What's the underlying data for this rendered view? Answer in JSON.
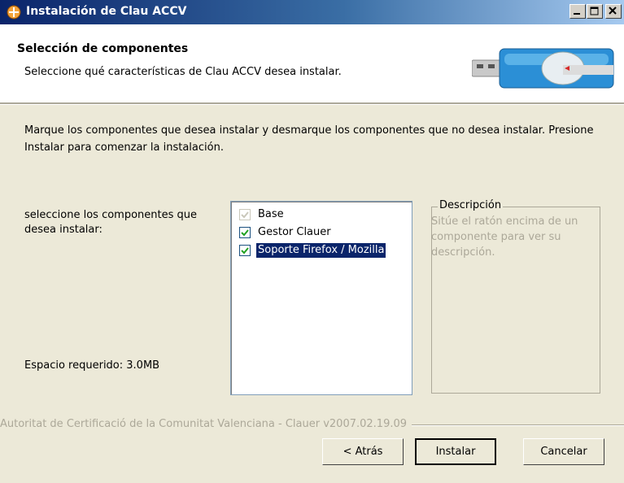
{
  "window": {
    "title": "Instalación de Clau ACCV"
  },
  "header": {
    "title": "Selección de componentes",
    "subtitle": "Seleccione qué características de Clau ACCV desea instalar."
  },
  "intro": "Marque los componentes que desea instalar y desmarque los componentes que no desea instalar. Presione Instalar para comenzar la instalación.",
  "select_label": "seleccione los componentes que desea instalar:",
  "space_required": "Espacio requerido: 3.0MB",
  "components": [
    {
      "label": "Base",
      "checked": true,
      "disabled": true
    },
    {
      "label": "Gestor Clauer",
      "checked": true,
      "disabled": false
    },
    {
      "label": "Soporte Firefox / Mozilla",
      "checked": true,
      "disabled": false,
      "selected": true
    }
  ],
  "description": {
    "legend": "Descripción",
    "text": "Sitúe el ratón encima de un componente para ver su descripción."
  },
  "footer_text": "Autoritat de Certificació de la Comunitat Valenciana - Clauer v2007.02.19.09",
  "buttons": {
    "back": "< Atrás",
    "install": "Instalar",
    "cancel": "Cancelar"
  },
  "colors": {
    "title_gradient_start": "#0a246a",
    "selection": "#0a246a",
    "check": "#21a121",
    "dialog_bg": "#ece9d8"
  }
}
